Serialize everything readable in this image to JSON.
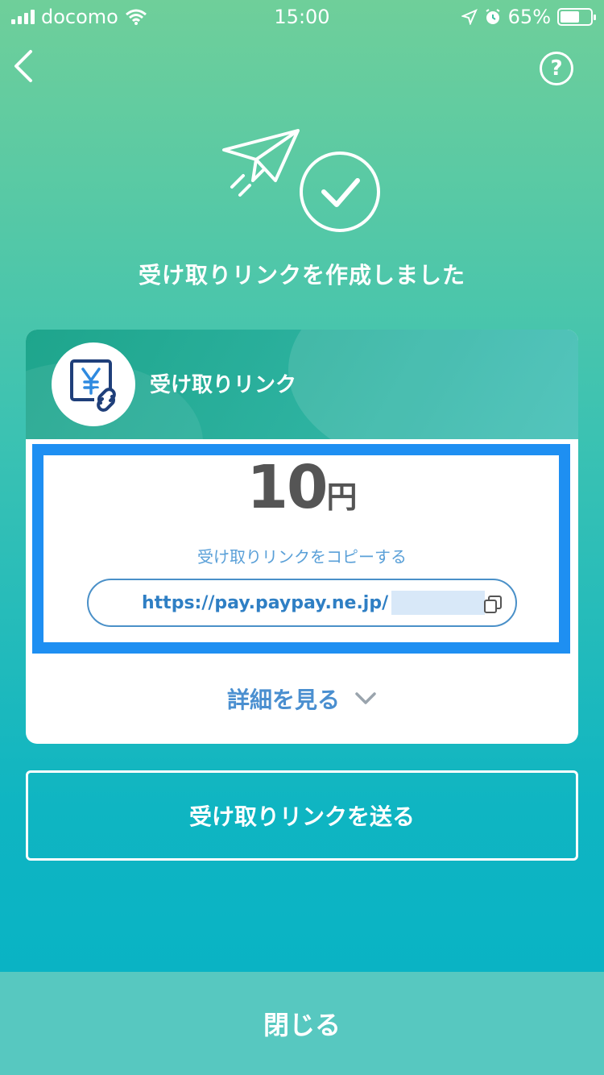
{
  "status_bar": {
    "carrier": "docomo",
    "time": "15:00",
    "battery": "65%",
    "battery_level": 0.65
  },
  "nav": {
    "help_label": "?"
  },
  "headline": "受け取りリンクを作成しました",
  "card": {
    "header_label": "受け取りリンク",
    "amount": "10",
    "currency": "円",
    "copy_label": "受け取りリンクをコピーする",
    "url": "https://pay.paypay.ne.jp/",
    "details_label": "詳細を見る"
  },
  "send_button": "受け取りリンクを送る",
  "close_button": "閉じる",
  "colors": {
    "highlight": "#1e8ff2",
    "link": "#2f7fc4",
    "close_bar": "#57c8c0"
  }
}
